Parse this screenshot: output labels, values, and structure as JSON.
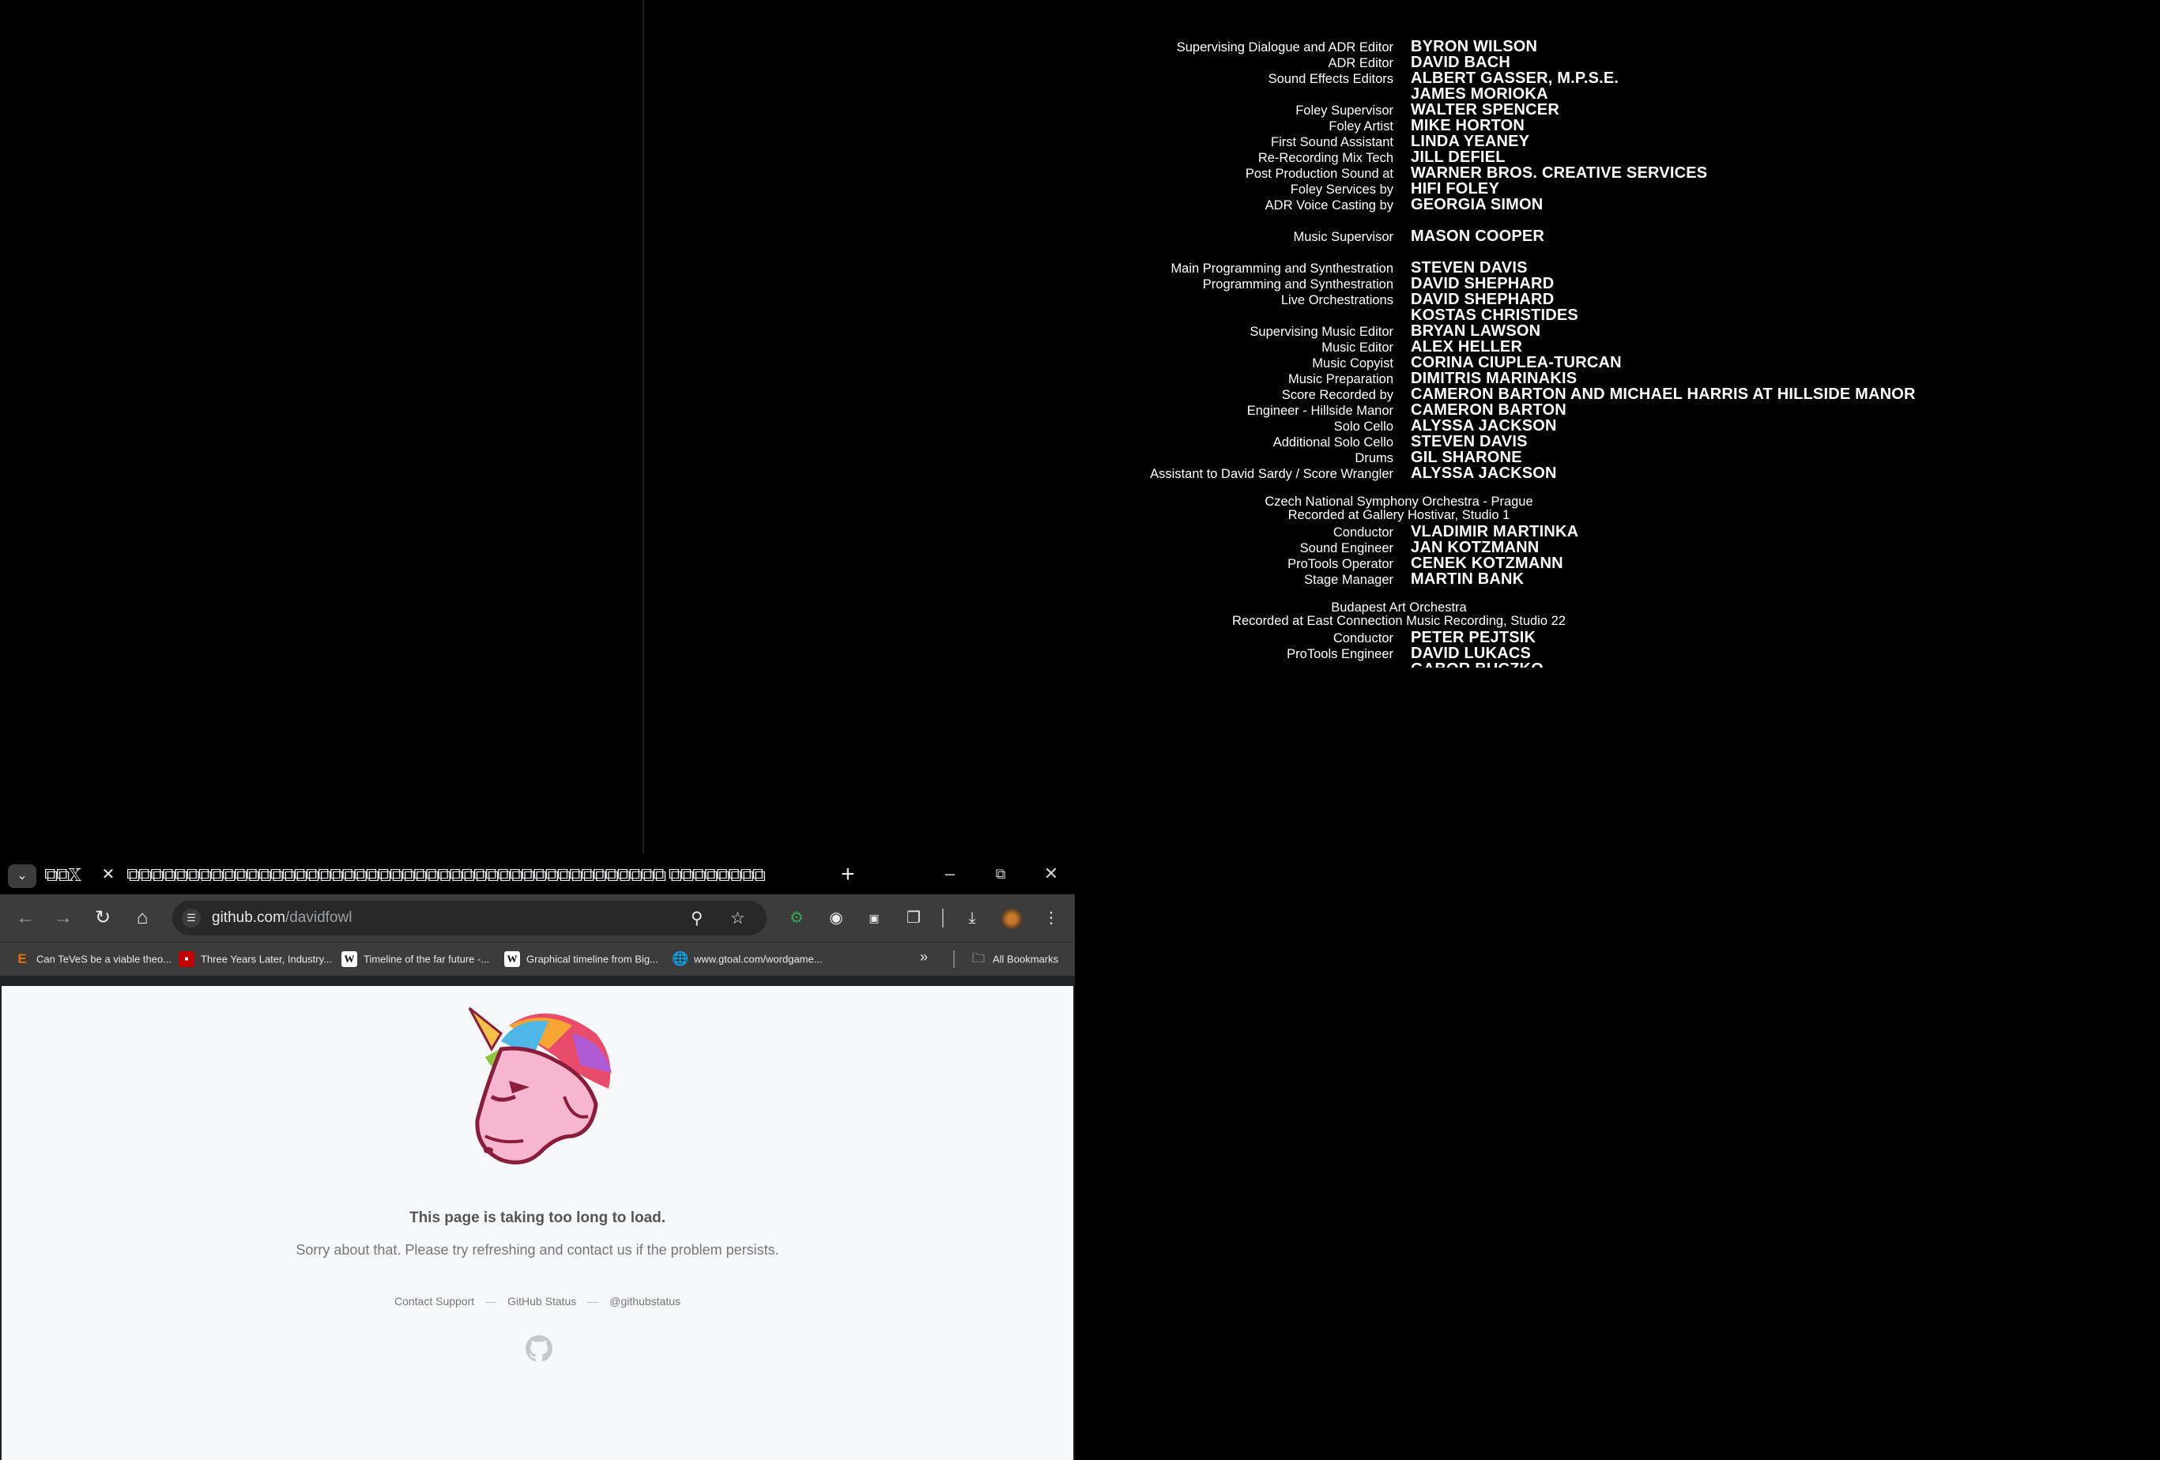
{
  "credits": {
    "rows": [
      {
        "role": "Supervising Dialogue and ADR Editor",
        "name": "BYRON WILSON"
      },
      {
        "role": "ADR Editor",
        "name": "DAVID BACH"
      },
      {
        "role": "Sound Effects Editors",
        "name": "ALBERT GASSER, M.P.S.E."
      },
      {
        "role": "",
        "name": "JAMES MORIOKA"
      },
      {
        "role": "Foley Supervisor",
        "name": "WALTER SPENCER"
      },
      {
        "role": "Foley Artist",
        "name": "MIKE HORTON"
      },
      {
        "role": "First Sound Assistant",
        "name": "LINDA YEANEY"
      },
      {
        "role": "Re-Recording Mix Tech",
        "name": "JILL DEFIEL"
      },
      {
        "role": "Post Production Sound at",
        "name": "WARNER BROS. CREATIVE SERVICES"
      },
      {
        "role": "Foley Services by",
        "name": "HIFI FOLEY"
      },
      {
        "role": "ADR Voice Casting by",
        "name": "GEORGIA SIMON"
      },
      {
        "role": "Music Supervisor",
        "name": "MASON COOPER"
      },
      {
        "role": "Main Programming and Synthestration",
        "name": "STEVEN DAVIS"
      },
      {
        "role": "Programming and Synthestration",
        "name": "DAVID SHEPHARD"
      },
      {
        "role": "Live Orchestrations",
        "name": "DAVID SHEPHARD"
      },
      {
        "role": "",
        "name": "KOSTAS CHRISTIDES"
      },
      {
        "role": "Supervising Music Editor",
        "name": "BRYAN LAWSON"
      },
      {
        "role": "Music Editor",
        "name": "ALEX HELLER"
      },
      {
        "role": "Music Copyist",
        "name": "CORINA CIUPLEA-TURCAN"
      },
      {
        "role": "Music Preparation",
        "name": "DIMITRIS MARINAKIS"
      },
      {
        "role": "Score Recorded by",
        "name": "CAMERON BARTON AND MICHAEL HARRIS AT HILLSIDE MANOR"
      },
      {
        "role": "Engineer - Hillside Manor",
        "name": "CAMERON BARTON"
      },
      {
        "role": "Solo Cello",
        "name": "ALYSSA JACKSON"
      },
      {
        "role": "Additional Solo Cello",
        "name": "STEVEN DAVIS"
      },
      {
        "role": "Drums",
        "name": "GIL SHARONE"
      },
      {
        "role": "Assistant to David Sardy / Score Wrangler",
        "name": "ALYSSA JACKSON"
      },
      {
        "role": "Conductor",
        "name": "VLADIMIR MARTINKA"
      },
      {
        "role": "Sound Engineer",
        "name": "JAN KOTZMANN"
      },
      {
        "role": "ProTools Operator",
        "name": "CENEK KOTZMANN"
      },
      {
        "role": "Stage Manager",
        "name": "MARTIN BANK"
      },
      {
        "role": "Conductor",
        "name": "PETER PEJTSIK"
      },
      {
        "role": "ProTools Engineer",
        "name": "DAVID LUKACS"
      },
      {
        "role": "",
        "name": "GABOR BUCZKO"
      }
    ],
    "headings": [
      "Czech National Symphony Orchestra - Prague",
      "Recorded at Gallery Hostivar, Studio 1",
      "Budapest Art Orchestra",
      "Recorded at East Connection Music Recording, Studio 22"
    ]
  },
  "browser": {
    "tab_title": "⧉⧉𝕏",
    "tab_title_2": "⧉⧉⧉⧉⧉⧉⧉⧉⧉⧉⧉⧉⧉⧉⧉⧉⧉⧉⧉⧉⧉⧉⧉⧉⧉⧉⧉⧉⧉⧉⧉⧉⧉⧉⧉⧉⧉⧉⧉⧉⧉⧉⧉⧉⧉ ⧉⧉⧉⧉⧉⧉⧉⧉",
    "url_host": "github.com",
    "url_path": "/davidfowl",
    "bookmarks": [
      {
        "label": "Can TeVeS be a viable theo...",
        "icon": "E",
        "color": "#e8710a"
      },
      {
        "label": "Three Years Later, Industry...",
        "icon": "■",
        "color": "#c00000"
      },
      {
        "label": "Timeline of the far future -...",
        "icon": "W",
        "color": "#ffffff"
      },
      {
        "label": "Graphical timeline from Big...",
        "icon": "W",
        "color": "#ffffff"
      },
      {
        "label": "www.gtoal.com/wordgame...",
        "icon": "◍",
        "color": "#e8eaed"
      }
    ],
    "all_bookmarks": "All Bookmarks"
  },
  "page": {
    "title": "This page is taking too long to load.",
    "subtitle": "Sorry about that. Please try refreshing and contact us if the problem persists.",
    "links": [
      "Contact Support",
      "GitHub Status",
      "@githubstatus"
    ],
    "link_separator": "—"
  }
}
